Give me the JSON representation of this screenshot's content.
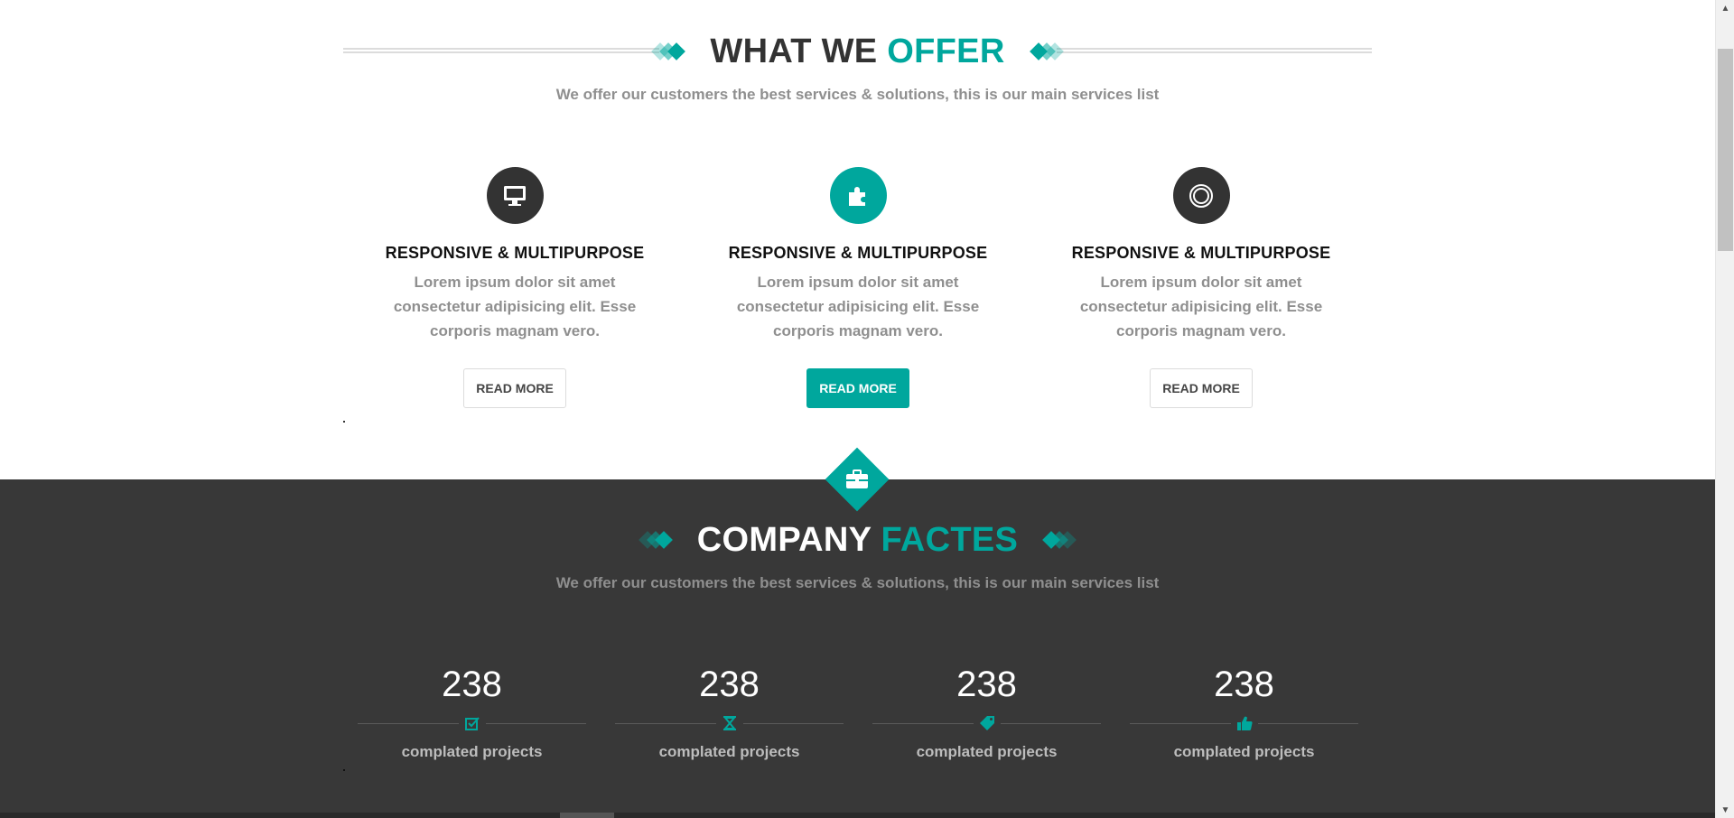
{
  "offer": {
    "title_dark": "WHAT WE ",
    "title_accent": "OFFER",
    "subtitle": "We offer our customers the best services & solutions, this is our main services list",
    "services": [
      {
        "icon": "monitor-icon",
        "title": "RESPONSIVE & MULTIPURPOSE",
        "text": "Lorem ipsum dolor sit amet consectetur adipisicing elit. Esse corporis magnam vero.",
        "button": "READ MORE"
      },
      {
        "icon": "puzzle-icon",
        "title": "RESPONSIVE & MULTIPURPOSE",
        "text": "Lorem ipsum dolor sit amet consectetur adipisicing elit. Esse corporis magnam vero.",
        "button": "READ MORE"
      },
      {
        "icon": "target-icon",
        "title": "RESPONSIVE & MULTIPURPOSE",
        "text": "Lorem ipsum dolor sit amet consectetur adipisicing elit. Esse corporis magnam vero.",
        "button": "READ MORE"
      }
    ]
  },
  "facts": {
    "badge_icon": "briefcase-icon",
    "title_dark": "COMPANY ",
    "title_accent": "FACTES",
    "subtitle": "We offer our customers the best services & solutions, this is our main services list",
    "counters": [
      {
        "number": "238",
        "icon": "checkbox-icon",
        "label": "complated projects"
      },
      {
        "number": "238",
        "icon": "hourglass-icon",
        "label": "complated projects"
      },
      {
        "number": "238",
        "icon": "tag-icon",
        "label": "complated projects"
      },
      {
        "number": "238",
        "icon": "thumbs-up-icon",
        "label": "complated projects"
      }
    ]
  },
  "colors": {
    "accent": "#00a79d",
    "dark": "#333333",
    "section_dark": "#383838",
    "muted_text": "#8f8f8f"
  }
}
